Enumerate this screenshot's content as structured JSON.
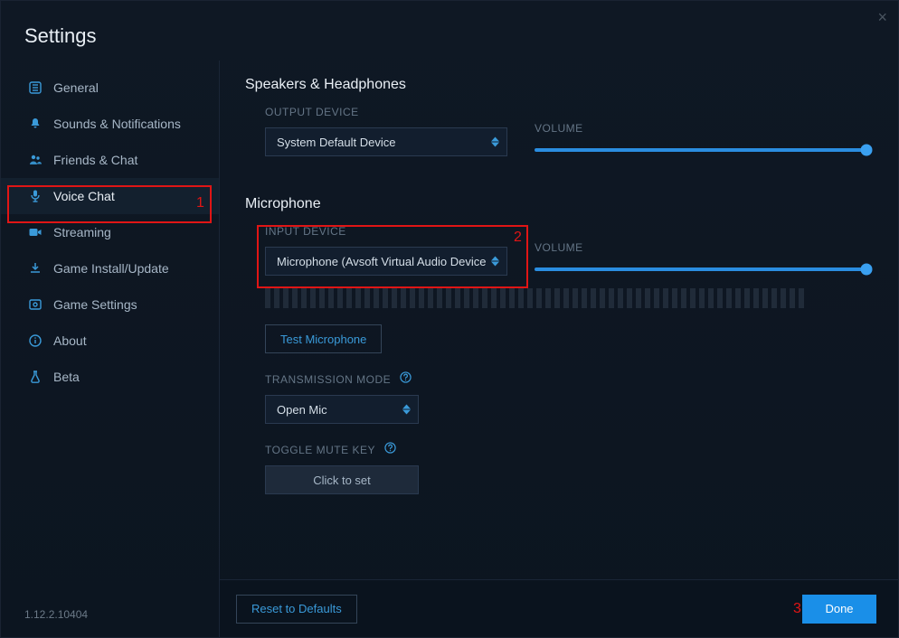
{
  "window": {
    "title": "Settings",
    "close_icon": "×",
    "version": "1.12.2.10404"
  },
  "sidebar": {
    "items": [
      {
        "icon": "settings",
        "label": "General"
      },
      {
        "icon": "bell",
        "label": "Sounds & Notifications"
      },
      {
        "icon": "friends",
        "label": "Friends & Chat"
      },
      {
        "icon": "mic",
        "label": "Voice Chat",
        "active": true
      },
      {
        "icon": "camera",
        "label": "Streaming"
      },
      {
        "icon": "download",
        "label": "Game Install/Update"
      },
      {
        "icon": "gear",
        "label": "Game Settings"
      },
      {
        "icon": "info",
        "label": "About"
      },
      {
        "icon": "flask",
        "label": "Beta"
      }
    ]
  },
  "sections": {
    "speakers": {
      "title": "Speakers & Headphones",
      "output_label": "OUTPUT DEVICE",
      "output_value": "System Default Device",
      "volume_label": "VOLUME",
      "volume_percent": 98
    },
    "mic": {
      "title": "Microphone",
      "input_label": "INPUT DEVICE",
      "input_value": "Microphone (Avsoft Virtual Audio Device",
      "volume_label": "VOLUME",
      "volume_percent": 98,
      "test_button": "Test Microphone",
      "transmission_label": "TRANSMISSION MODE",
      "transmission_value": "Open Mic",
      "toggle_label": "TOGGLE MUTE KEY",
      "toggle_button": "Click to set"
    }
  },
  "footer": {
    "reset": "Reset to Defaults",
    "done": "Done"
  },
  "annotations": {
    "n1": "1",
    "n2": "2",
    "n3": "3"
  },
  "colors": {
    "accent": "#2a8de0",
    "error": "#e01515"
  }
}
